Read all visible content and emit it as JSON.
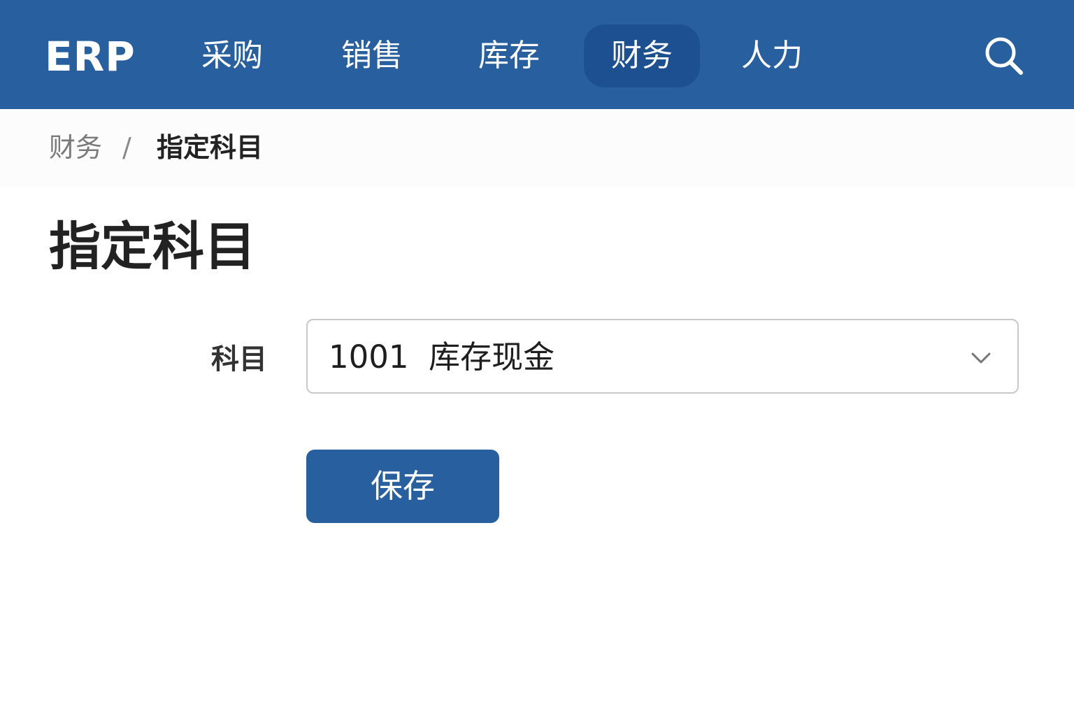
{
  "header": {
    "brand": "ERP",
    "nav": [
      {
        "label": "采购",
        "active": false
      },
      {
        "label": "销售",
        "active": false
      },
      {
        "label": "库存",
        "active": false
      },
      {
        "label": "财务",
        "active": true
      },
      {
        "label": "人力",
        "active": false
      }
    ],
    "search_icon": "search-icon"
  },
  "breadcrumb": {
    "parent": "财务",
    "separator": "/",
    "current": "指定科目"
  },
  "page": {
    "title": "指定科目"
  },
  "form": {
    "account_label": "科目",
    "account_value": "1001  库存现金",
    "dropdown_icon": "chevron-down-icon",
    "save_label": "保存"
  },
  "colors": {
    "primary": "#285f9e",
    "nav_active": "#1c5090",
    "text_dark": "#222222",
    "text_muted": "#7a7a7a",
    "border": "#c8c8c8"
  }
}
